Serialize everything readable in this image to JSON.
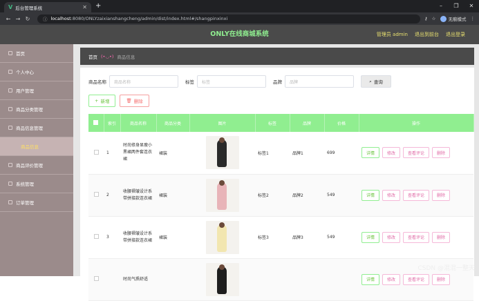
{
  "browser": {
    "tab_title": "后台管理系统",
    "url_host": "localhost",
    "url_rest": ":8080/ONLYzaixianshangcheng/admin/dist/index.html#/shangpinxinxi",
    "incognito_label": "无痕模式"
  },
  "header": {
    "title": "ONLY在线商城系统",
    "admin_label": "管理员 admin",
    "back_label": "退出到前台",
    "logout_label": "退出登录"
  },
  "sidebar": {
    "items": [
      {
        "label": "首页"
      },
      {
        "label": "个人中心"
      },
      {
        "label": "用户管理"
      },
      {
        "label": "商品分类管理"
      },
      {
        "label": "商品信息管理"
      },
      {
        "label": "商品信息"
      },
      {
        "label": "商品评价管理"
      },
      {
        "label": "系统管理"
      },
      {
        "label": "订单管理"
      }
    ]
  },
  "breadcrumb": {
    "home": "首页",
    "separator": "(•◡•)",
    "current": "商品信息"
  },
  "search": {
    "name_label": "商品名称",
    "name_placeholder": "商品名称",
    "tag_label": "标签",
    "tag_placeholder": "标签",
    "brand_label": "品牌",
    "brand_placeholder": "品牌",
    "query_label": "查询"
  },
  "actions": {
    "add_label": "新增",
    "delete_label": "删除"
  },
  "table": {
    "headers": [
      "",
      "索引",
      "商品名称",
      "商品分类",
      "图片",
      "标签",
      "品牌",
      "价格",
      "操作"
    ],
    "rows": [
      {
        "index": "1",
        "name": "时尚修身显瘦小黑裙两件套连衣裙",
        "category": "裙装",
        "tag": "标签1",
        "brand": "品牌1",
        "price": "699",
        "color": "#2a2a2a"
      },
      {
        "index": "2",
        "name": "收腰褶皱设计系带拼接款连衣裙",
        "category": "裙装",
        "tag": "标签2",
        "brand": "品牌2",
        "price": "549",
        "color": "#e8b4b8"
      },
      {
        "index": "3",
        "name": "收腰褶皱设计系带拼接款连衣裙",
        "category": "裙装",
        "tag": "标签3",
        "brand": "品牌3",
        "price": "549",
        "color": "#f2e6b0"
      },
      {
        "index": "",
        "name": "时尚气质舒适",
        "category": "",
        "tag": "",
        "brand": "",
        "price": "",
        "color": "#1e1e1e"
      }
    ],
    "ops": {
      "view": "详情",
      "edit": "修改",
      "review": "查看评论",
      "delete": "删除"
    }
  },
  "watermark": "CSDN @混混一整天"
}
